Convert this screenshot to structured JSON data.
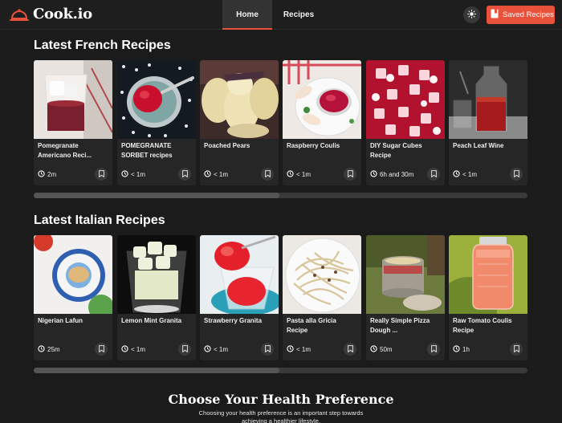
{
  "header": {
    "brand": "Cook.io",
    "nav": [
      {
        "label": "Home",
        "active": true
      },
      {
        "label": "Recipes",
        "active": false
      }
    ],
    "saved_label": "Saved Recipes",
    "accent": "#e8513a"
  },
  "sections": [
    {
      "title": "Latest French Recipes",
      "cards": [
        {
          "title": "Pomegranate Americano Reci...",
          "time": "2m"
        },
        {
          "title": "POMEGRANATE SORBET recipes",
          "time": "< 1m"
        },
        {
          "title": "Poached Pears",
          "time": "< 1m"
        },
        {
          "title": "Raspberry Coulis",
          "time": "< 1m"
        },
        {
          "title": "DIY Sugar Cubes Recipe",
          "time": "6h and 30m"
        },
        {
          "title": "Peach Leaf Wine",
          "time": "< 1m"
        }
      ]
    },
    {
      "title": "Latest Italian Recipes",
      "cards": [
        {
          "title": "Nigerian Lafun",
          "time": "25m"
        },
        {
          "title": "Lemon Mint Granita",
          "time": "< 1m"
        },
        {
          "title": "Strawberry Granita",
          "time": "< 1m"
        },
        {
          "title": "Pasta alla Gricia Recipe",
          "time": "< 1m"
        },
        {
          "title": "Really Simple Pizza Dough ...",
          "time": "50m"
        },
        {
          "title": "Raw Tomato Coulis Recipe",
          "time": "1h"
        }
      ]
    }
  ],
  "health": {
    "title": "Choose Your Health Preference",
    "subtitle": "Choosing your health preference is an important step towards achieving a healthier lifestyle."
  }
}
